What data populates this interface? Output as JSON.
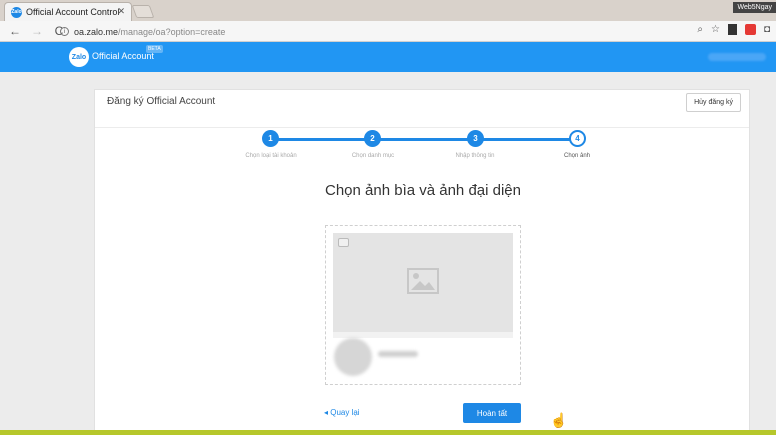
{
  "browser": {
    "tab_title": "Official Account Control",
    "tab_close": "✕",
    "favicon_text": "Zalo",
    "window_label": "Web5Ngay",
    "url_host": "oa.zalo.me",
    "url_path": "/manage/oa?option=create",
    "back_glyph": "←",
    "forward_glyph": "→",
    "reload_glyph": "C"
  },
  "header": {
    "logo_text": "Zalo",
    "brand": "Official Account",
    "badge": "BETA"
  },
  "card": {
    "title": "Đăng ký Official Account",
    "cancel_label": "Hủy đăng ký"
  },
  "stepper": {
    "current_step": 4,
    "steps": [
      {
        "number": "1",
        "label": "Chọn loại tài khoản"
      },
      {
        "number": "2",
        "label": "Chọn danh mục"
      },
      {
        "number": "3",
        "label": "Nhập thông tin"
      },
      {
        "number": "4",
        "label": "Chọn ảnh"
      }
    ]
  },
  "main": {
    "heading": "Chọn ảnh bìa và ảnh đại diện",
    "back_label": "◂ Quay lại",
    "finish_label": "Hoàn tất"
  },
  "icons": {
    "cover_placeholder": "image-icon",
    "camera": "camera-icon",
    "cursor": "hand-cursor-icon"
  },
  "colors": {
    "brand_blue": "#2196f3",
    "accent_blue": "#1e88e5"
  }
}
